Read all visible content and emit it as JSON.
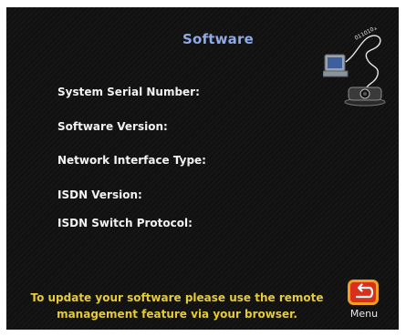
{
  "screen": {
    "title": "Software"
  },
  "fields": {
    "serial_number": "System Serial Number:",
    "software_version": "Software Version:",
    "network_interface_type": "Network Interface Type:",
    "isdn_version": "ISDN Version:",
    "isdn_switch_protocol": "ISDN Switch Protocol:"
  },
  "footer": {
    "note_line1": "To update your software please use the remote",
    "note_line2": "management feature via your browser."
  },
  "menu_button": {
    "label": "Menu",
    "icon": "return-arrow-icon"
  },
  "illustration": {
    "icon": "computer-data-transfer-icon",
    "binary_text": "0110101"
  },
  "colors": {
    "title": "#8fa9e6",
    "label": "#f2f2f2",
    "note": "#e6cc33",
    "menu_icon_border": "#f0a020",
    "menu_icon_fill": "#d8301c"
  }
}
